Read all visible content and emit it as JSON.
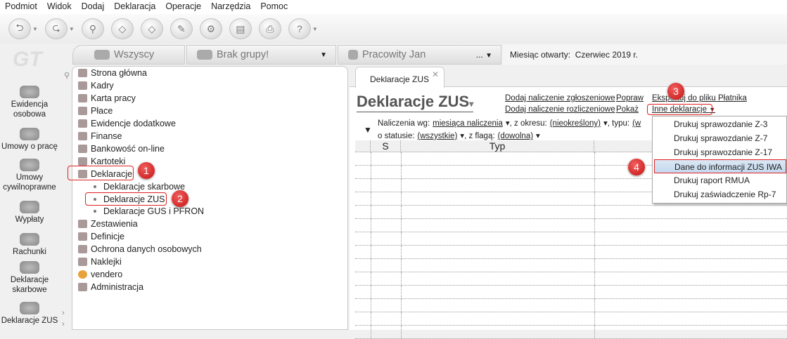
{
  "menu": [
    "Podmiot",
    "Widok",
    "Dodaj",
    "Deklaracja",
    "Operacje",
    "Narzędzia",
    "Pomoc"
  ],
  "logo": "GT",
  "group_tabs": {
    "all": "Wszyscy",
    "group": "Brak grupy!",
    "employee": "Pracowity Jan",
    "employee_more": "...",
    "month_label": "Miesiąc otwarty:",
    "month_value": "Czerwiec 2019 r."
  },
  "sidebar": [
    "Ewidencja osobowa",
    "Umowy o pracę",
    "Umowy cywilnoprawne",
    "Wypłaty",
    "Rachunki",
    "Deklaracje skarbowe",
    "Deklaracje ZUS"
  ],
  "tree": [
    "Strona główna",
    "Kadry",
    "Karta pracy",
    "Płace",
    "Ewidencje dodatkowe",
    "Finanse",
    "Bankowość on-line",
    "Kartoteki",
    "Deklaracje",
    "Deklaracje skarbowe",
    "Deklaracje ZUS",
    "Deklaracje GUS i PFRON",
    "Zestawienia",
    "Definicje",
    "Ochrona danych osobowych",
    "Naklejki",
    "vendero",
    "Administracja"
  ],
  "badges": [
    "1",
    "2",
    "3",
    "4"
  ],
  "main": {
    "tab": "Deklaracje ZUS",
    "title": "Deklaracje ZUS",
    "links": {
      "add_reg": "Dodaj naliczenie zgłoszeniowe",
      "add_settle": "Dodaj naliczenie rozliczeniowe",
      "fix": "Popraw",
      "show": "Pokaż",
      "export": "Eksportuj do pliku Płatnika",
      "other": "Inne deklaracje"
    },
    "filters": {
      "by_label": "Naliczenia wg:",
      "by_value": "miesiąca naliczenia",
      "period_label": ", z okresu:",
      "period_value": "(nieokreślony)",
      "type_label": ", typu:",
      "type_value": "(w",
      "status_label": "o statusie:",
      "status_value": "(wszystkie)",
      "flag_label": ", z flagą:",
      "flag_value": "(dowolna)"
    },
    "columns": [
      "S",
      "Typ"
    ]
  },
  "dropdown": [
    "Drukuj sprawozdanie Z-3",
    "Drukuj sprawozdanie Z-7",
    "Drukuj sprawozdanie Z-17",
    "Dane do informacji ZUS IWA",
    "Drukuj raport RMUA",
    "Drukuj zaświadczenie Rp-7"
  ]
}
